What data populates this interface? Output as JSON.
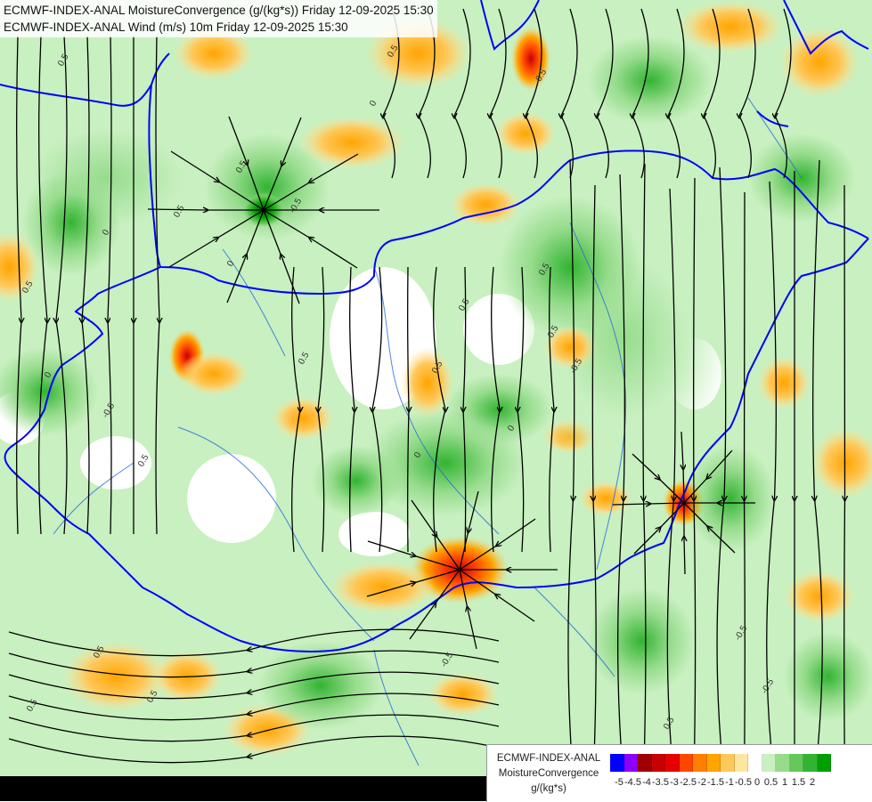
{
  "header": {
    "line1": "ECMWF-INDEX-ANAL MoistureConvergence (g/(kg*s)) Friday 12-09-2025 15:30",
    "line2": "ECMWF-INDEX-ANAL Wind (m/s) 10m Friday 12-09-2025 15:30"
  },
  "legend": {
    "model": "ECMWF-INDEX-ANAL",
    "field": "MoistureConvergence",
    "unit": "g/(kg*s)",
    "colors": [
      "#0000ff",
      "#8b00ff",
      "#a00000",
      "#c80000",
      "#e60000",
      "#ff4500",
      "#ff7f00",
      "#ffa500",
      "#ffc85a",
      "#ffe6a0",
      "#ffffff",
      "#c8f0c0",
      "#96dc8c",
      "#64c85a",
      "#32b432",
      "#00a000"
    ],
    "tick_labels": [
      "-5",
      "-4.5",
      "-4",
      "-3.5",
      "-3",
      "-2.5",
      "-2",
      "-1.5",
      "-1",
      "-0.5",
      "0",
      "0.5",
      "1",
      "1.5",
      "2"
    ]
  },
  "map": {
    "contour_labels": [
      "0.5",
      "0",
      "0.5",
      "-0.5",
      "0.5",
      "0",
      "0.5",
      "-0.5",
      "0.5",
      "0.5",
      "0",
      "-0.5",
      "0.5",
      "0.5",
      "0",
      "0.5",
      "-0.5",
      "0.5",
      "0.5",
      "0.5",
      "-0.5",
      "0.5",
      "0.5",
      "-0.5",
      "0.5",
      "0",
      "0",
      "-0.5"
    ],
    "colors": {
      "border": "#0000ff",
      "river": "#2266dd",
      "streamline": "#000000",
      "contour": "#333333"
    }
  }
}
